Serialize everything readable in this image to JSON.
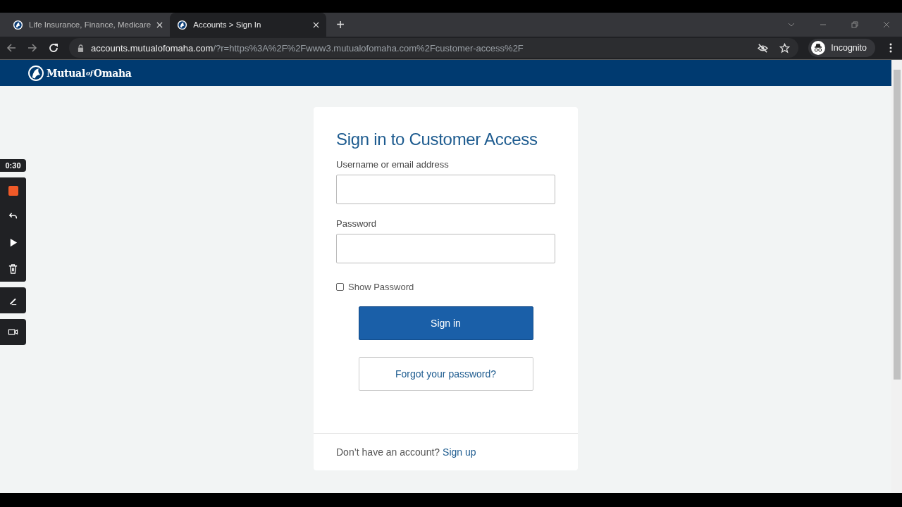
{
  "browser": {
    "tabs": [
      {
        "title": "Life Insurance, Finance, Medicare",
        "selected": false
      },
      {
        "title": "Accounts > Sign In",
        "selected": true
      }
    ],
    "new_tab": "+",
    "url_host": "accounts.mutualofomaha.com",
    "url_rest": "/?r=https%3A%2F%2Fwww3.mutualofomaha.com%2Fcustomer-access%2F",
    "profile": "Incognito"
  },
  "recorder": {
    "timer": "0:30"
  },
  "header": {
    "logo": {
      "first": "Mutual",
      "joiner": "of",
      "last": "Omaha"
    }
  },
  "form": {
    "title": "Sign in to Customer Access",
    "fields": [
      {
        "label": "Username or email address"
      },
      {
        "label": "Password"
      }
    ],
    "show_password": {
      "label": "Show Password",
      "checked": false
    },
    "sign_in": "Sign in",
    "forgot": "Forgot your password?",
    "footer_text": "Don’t have an account?",
    "signup": "Sign up"
  }
}
